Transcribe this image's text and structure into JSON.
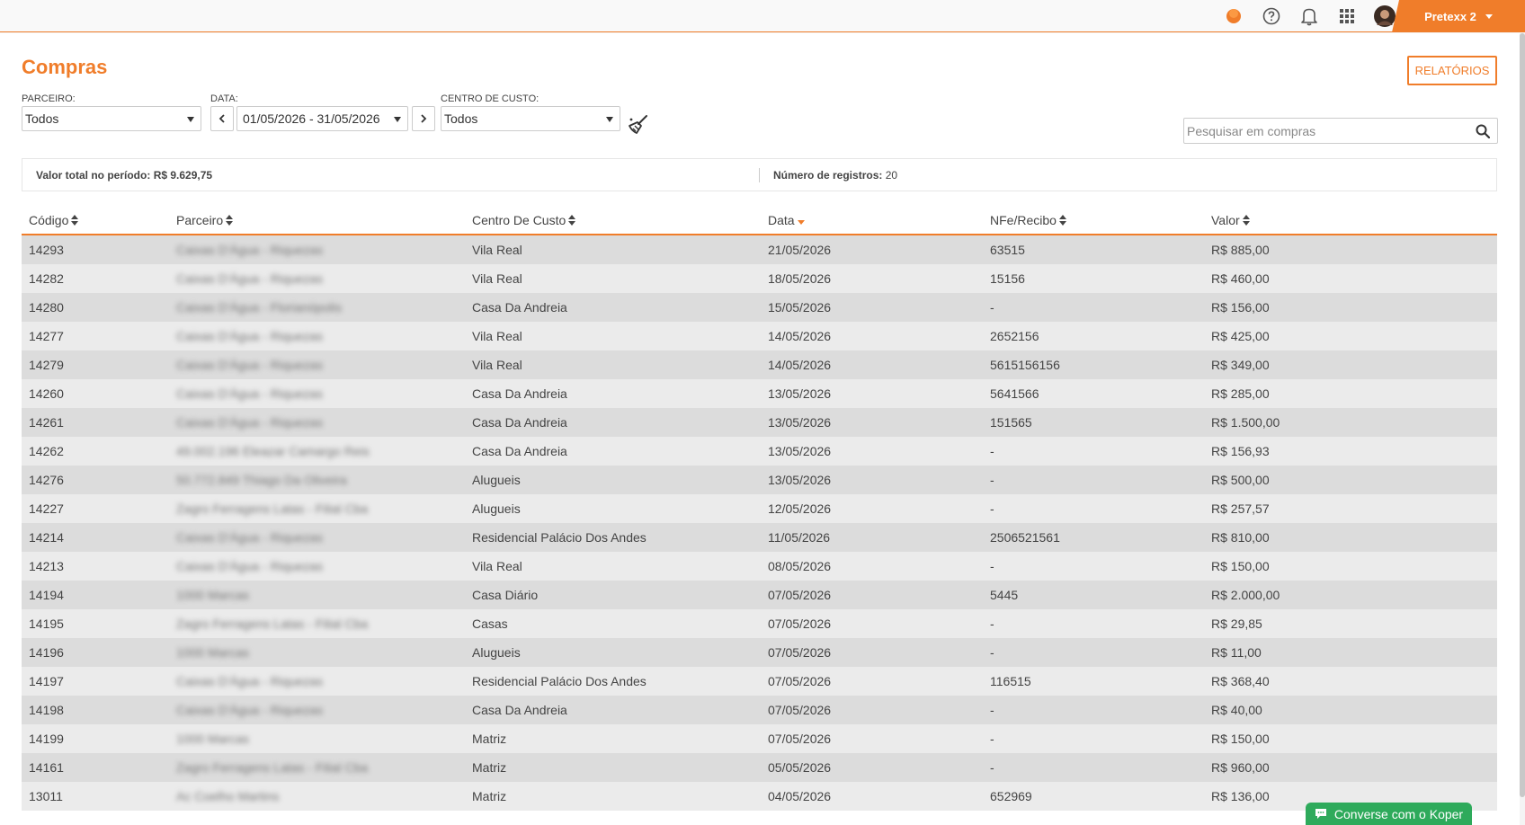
{
  "user": {
    "name": "Pretexx 2"
  },
  "page": {
    "title": "Compras",
    "reports_label": "RELATÓRIOS"
  },
  "filters": {
    "partner_label": "PARCEIRO:",
    "partner_value": "Todos",
    "date_label": "DATA:",
    "date_value": "01/05/2026 - 31/05/2026",
    "cost_center_label": "CENTRO DE CUSTO:",
    "cost_center_value": "Todos",
    "search_placeholder": "Pesquisar em compras"
  },
  "summary": {
    "total_label": "Valor total no período:",
    "total_value": "R$ 9.629,75",
    "count_label": "Número de registros:",
    "count_value": "20"
  },
  "table": {
    "headers": [
      "Código",
      "Parceiro",
      "Centro De Custo",
      "Data",
      "NFe/Recibo",
      "Valor"
    ],
    "rows": [
      [
        "14293",
        "Caixas D'Água - Riquezas",
        "Vila Real",
        "21/05/2026",
        "63515",
        "R$ 885,00"
      ],
      [
        "14282",
        "Caixas D'Água - Riquezas",
        "Vila Real",
        "18/05/2026",
        "15156",
        "R$ 460,00"
      ],
      [
        "14280",
        "Caixas D'Água - Florianópolis",
        "Casa Da Andreia",
        "15/05/2026",
        "-",
        "R$ 156,00"
      ],
      [
        "14277",
        "Caixas D'Água - Riquezas",
        "Vila Real",
        "14/05/2026",
        "2652156",
        "R$ 425,00"
      ],
      [
        "14279",
        "Caixas D'Água - Riquezas",
        "Vila Real",
        "14/05/2026",
        "5615156156",
        "R$ 349,00"
      ],
      [
        "14260",
        "Caixas D'Água - Riquezas",
        "Casa Da Andreia",
        "13/05/2026",
        "5641566",
        "R$ 285,00"
      ],
      [
        "14261",
        "Caixas D'Água - Riquezas",
        "Casa Da Andreia",
        "13/05/2026",
        "151565",
        "R$ 1.500,00"
      ],
      [
        "14262",
        "49.002.196 Eleazar Camargo Reis",
        "Casa Da Andreia",
        "13/05/2026",
        "-",
        "R$ 156,93"
      ],
      [
        "14276",
        "50.772.849 Thiago Da Oliveira",
        "Alugueis",
        "13/05/2026",
        "-",
        "R$ 500,00"
      ],
      [
        "14227",
        "Zagro Ferragens Latas - Filial Cba",
        "Alugueis",
        "12/05/2026",
        "-",
        "R$ 257,57"
      ],
      [
        "14214",
        "Caixas D'Água - Riquezas",
        "Residencial Palácio Dos Andes",
        "11/05/2026",
        "2506521561",
        "R$ 810,00"
      ],
      [
        "14213",
        "Caixas D'Água - Riquezas",
        "Vila Real",
        "08/05/2026",
        "-",
        "R$ 150,00"
      ],
      [
        "14194",
        "1000 Marcas",
        "Casa Diário",
        "07/05/2026",
        "5445",
        "R$ 2.000,00"
      ],
      [
        "14195",
        "Zagro Ferragens Latas - Filial Cba",
        "Casas",
        "07/05/2026",
        "-",
        "R$ 29,85"
      ],
      [
        "14196",
        "1000 Marcas",
        "Alugueis",
        "07/05/2026",
        "-",
        "R$ 11,00"
      ],
      [
        "14197",
        "Caixas D'Água - Riquezas",
        "Residencial Palácio Dos Andes",
        "07/05/2026",
        "116515",
        "R$ 368,40"
      ],
      [
        "14198",
        "Caixas D'Água - Riquezas",
        "Casa Da Andreia",
        "07/05/2026",
        "-",
        "R$ 40,00"
      ],
      [
        "14199",
        "1000 Marcas",
        "Matriz",
        "07/05/2026",
        "-",
        "R$ 150,00"
      ],
      [
        "14161",
        "Zagro Ferragens Latas - Filial Cba",
        "Matriz",
        "05/05/2026",
        "-",
        "R$ 960,00"
      ],
      [
        "13011",
        "Ac Coelho Martins",
        "Matriz",
        "04/05/2026",
        "652969",
        "R$ 136,00"
      ]
    ]
  },
  "chat": {
    "label": "Converse com o Koper"
  },
  "colors": {
    "accent": "#f07d2a",
    "chat": "#2eaa5b"
  }
}
